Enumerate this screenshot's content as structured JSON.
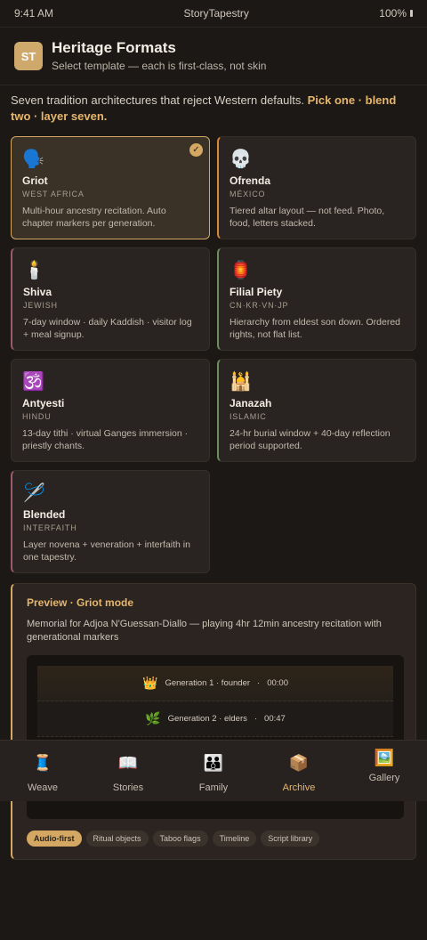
{
  "status": {
    "time": "9:41 AM",
    "carrier": "StoryTapestry",
    "battery": "100%"
  },
  "header": {
    "avatar": "ST",
    "title": "Heritage Formats",
    "subtitle": "Select template — each is first-class, not skin"
  },
  "intro": {
    "text": "Seven tradition architectures that reject Western defaults. ",
    "emphasis": "Pick one · blend two · layer seven."
  },
  "formats": [
    {
      "icon": "🗣️",
      "name": "Griot",
      "region": "WEST AFRICA",
      "desc": "Multi-hour ancestry recitation. Auto chapter markers per generation.",
      "selected": true
    },
    {
      "icon": "💀",
      "name": "Ofrenda",
      "region": "MÉXICO",
      "desc": "Tiered altar layout — not feed. Photo, food, letters stacked."
    },
    {
      "icon": "🕯️",
      "name": "Shiva",
      "region": "JEWISH",
      "desc": "7-day window · daily Kaddish · visitor log + meal signup."
    },
    {
      "icon": "🏮",
      "name": "Filial Piety",
      "region": "CN·KR·VN·JP",
      "desc": "Hierarchy from eldest son down. Ordered rights, not flat list."
    },
    {
      "icon": "🕉️",
      "name": "Antyesti",
      "region": "HINDU",
      "desc": "13-day tithi · virtual Ganges immersion · priestly chants."
    },
    {
      "icon": "🕌",
      "name": "Janazah",
      "region": "ISLAMIC",
      "desc": "24-hr burial window + 40-day reflection period supported."
    },
    {
      "icon": "🪡",
      "name": "Blended",
      "region": "INTERFAITH",
      "desc": "Layer novena + veneration + interfaith in one tapestry."
    }
  ],
  "preview": {
    "title": "Preview · Griot mode",
    "desc": "Memorial for Adjoa N'Guessan-Diallo — playing 4hr 12min ancestry recitation with generational markers",
    "rows": [
      {
        "icon": "👑",
        "label": "Generation 1 · founder",
        "time": "00:00"
      },
      {
        "icon": "🌿",
        "label": "Generation 2 · elders",
        "time": "00:47"
      }
    ],
    "tags": [
      "Audio-first",
      "Ritual objects",
      "Taboo flags",
      "Timeline",
      "Script library"
    ]
  },
  "tabs": [
    {
      "icon": "🧵",
      "label": "Weave"
    },
    {
      "icon": "📖",
      "label": "Stories"
    },
    {
      "icon": "👪",
      "label": "Family"
    },
    {
      "icon": "📦",
      "label": "Archive",
      "active": true
    },
    {
      "icon": "🖼️",
      "label": "Gallery"
    }
  ]
}
